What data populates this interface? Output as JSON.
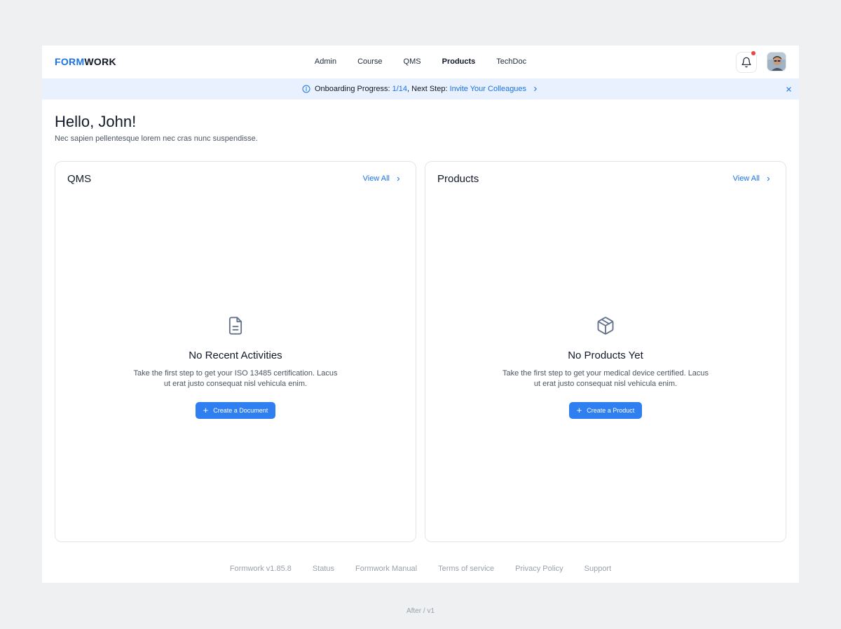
{
  "brand": {
    "part1": "FORM",
    "part2": "WORK"
  },
  "nav": [
    {
      "label": "Admin"
    },
    {
      "label": "Course"
    },
    {
      "label": "QMS"
    },
    {
      "label": "Products"
    },
    {
      "label": "TechDoc"
    }
  ],
  "nav_active": "Products",
  "banner": {
    "prefix": "Onboarding Progress: ",
    "progress": "1/14",
    "middle": ", Next Step: ",
    "link": "Invite Your Colleagues"
  },
  "greeting": {
    "title": "Hello, John!",
    "subtitle": "Nec sapien pellentesque lorem nec cras nunc suspendisse."
  },
  "cards": [
    {
      "title": "QMS",
      "view_all": "View All",
      "icon": "document-icon",
      "empty_title": "No Recent Activities",
      "empty_desc": "Take the first step to get your ISO 13485 certification. Lacus ut erat justo consequat nisl vehicula enim.",
      "button": "Create a Document"
    },
    {
      "title": "Products",
      "view_all": "View All",
      "icon": "box-icon",
      "empty_title": "No Products Yet",
      "empty_desc": "Take the first step to get your medical device certified. Lacus ut erat justo consequat nisl vehicula enim.",
      "button": "Create a Product"
    }
  ],
  "footer": [
    {
      "label": "Formwork v1.85.8"
    },
    {
      "label": "Status"
    },
    {
      "label": "Formwork Manual"
    },
    {
      "label": "Terms of service"
    },
    {
      "label": "Privacy Policy"
    },
    {
      "label": "Support"
    }
  ],
  "caption": "After / v1",
  "colors": {
    "accent": "#1a73e8",
    "button": "#2f7ff0",
    "banner_bg": "#e8f1fd",
    "notification_dot": "#ef4444"
  }
}
